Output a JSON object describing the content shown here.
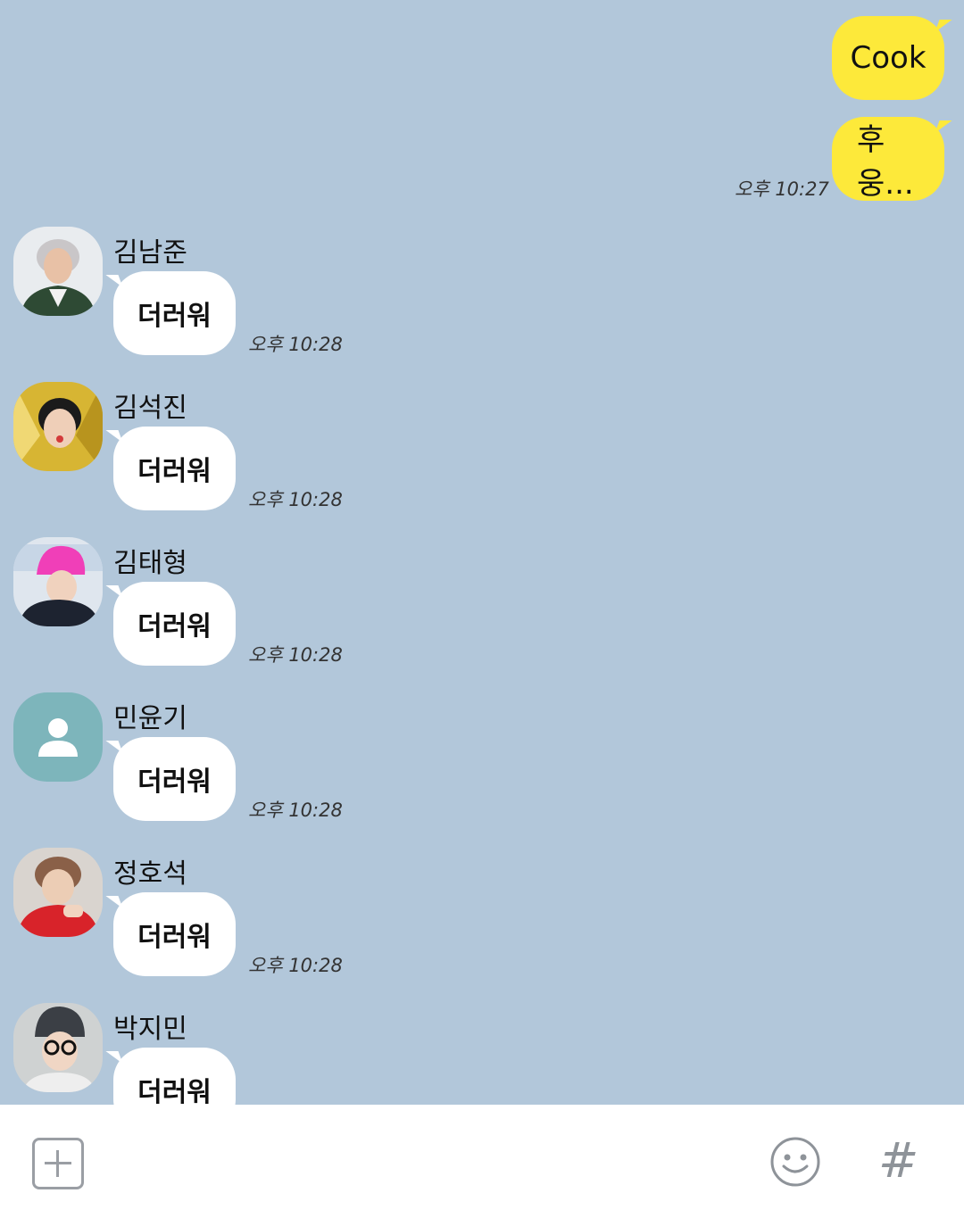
{
  "outgoing": [
    {
      "text": "Cook",
      "time": ""
    },
    {
      "text": "후웅...",
      "time": "오후 10:27"
    }
  ],
  "incoming": [
    {
      "sender": "김남준",
      "text": "더러워",
      "time": "오후 10:28",
      "avatar": "photo"
    },
    {
      "sender": "김석진",
      "text": "더러워",
      "time": "오후 10:28",
      "avatar": "photo"
    },
    {
      "sender": "김태형",
      "text": "더러워",
      "time": "오후 10:28",
      "avatar": "photo"
    },
    {
      "sender": "민윤기",
      "text": "더러워",
      "time": "오후 10:28",
      "avatar": "default-person"
    },
    {
      "sender": "정호석",
      "text": "더러워",
      "time": "오후 10:28",
      "avatar": "photo"
    },
    {
      "sender": "박지민",
      "text": "더러워",
      "time": "",
      "avatar": "photo"
    }
  ],
  "input_bar": {
    "plus_icon": "plus-square-icon",
    "emoji_icon": "smiley-icon",
    "hash_label": "#"
  },
  "colors": {
    "background": "#b2c7da",
    "outgoing_bubble": "#fde93a",
    "incoming_bubble": "#ffffff",
    "default_avatar": "#7db5bb"
  }
}
